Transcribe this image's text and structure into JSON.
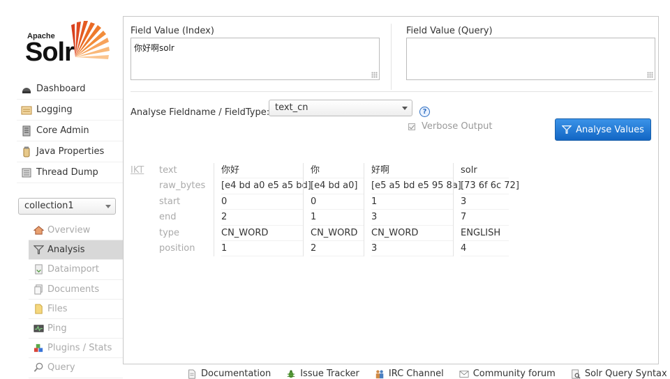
{
  "logo": {
    "brand_small": "Apache",
    "brand_large": "Solr"
  },
  "main_menu": [
    {
      "label": "Dashboard",
      "icon": "dashboard-icon"
    },
    {
      "label": "Logging",
      "icon": "logging-icon"
    },
    {
      "label": "Core Admin",
      "icon": "core-admin-icon"
    },
    {
      "label": "Java Properties",
      "icon": "java-properties-icon"
    },
    {
      "label": "Thread Dump",
      "icon": "thread-dump-icon"
    }
  ],
  "core_selector": {
    "value": "collection1"
  },
  "core_menu": [
    {
      "label": "Overview",
      "icon": "home-icon",
      "active": false
    },
    {
      "label": "Analysis",
      "icon": "filter-icon",
      "active": true
    },
    {
      "label": "Dataimport",
      "icon": "dataimport-icon",
      "active": false
    },
    {
      "label": "Documents",
      "icon": "documents-icon",
      "active": false
    },
    {
      "label": "Files",
      "icon": "files-icon",
      "active": false
    },
    {
      "label": "Ping",
      "icon": "ping-icon",
      "active": false
    },
    {
      "label": "Plugins / Stats",
      "icon": "plugins-icon",
      "active": false
    },
    {
      "label": "Query",
      "icon": "query-icon",
      "active": false
    }
  ],
  "analysis": {
    "index_label": "Field Value (Index)",
    "index_value": "你好啊solr",
    "query_label": "Field Value (Query)",
    "query_value": "",
    "fieldtype_label": "Analyse Fieldname / FieldType:",
    "fieldtype_value": "text_cn",
    "verbose_label": "Verbose Output",
    "verbose_checked": true,
    "analyse_button": "Analyse Values",
    "tokenizer": "IKT",
    "attributes": [
      "text",
      "raw_bytes",
      "start",
      "end",
      "type",
      "position"
    ],
    "tokens": [
      {
        "text": "你好",
        "raw_bytes": "[e4 bd a0 e5 a5 bd]",
        "start": "0",
        "end": "2",
        "type": "CN_WORD",
        "position": "1"
      },
      {
        "text": "你",
        "raw_bytes": "[e4 bd a0]",
        "start": "0",
        "end": "1",
        "type": "CN_WORD",
        "position": "2"
      },
      {
        "text": "好啊",
        "raw_bytes": "[e5 a5 bd e5 95 8a]",
        "start": "1",
        "end": "3",
        "type": "CN_WORD",
        "position": "3"
      },
      {
        "text": "solr",
        "raw_bytes": "[73 6f 6c 72]",
        "start": "3",
        "end": "7",
        "type": "ENGLISH",
        "position": "4"
      }
    ]
  },
  "footer": [
    {
      "label": "Documentation",
      "icon": "documentation-icon"
    },
    {
      "label": "Issue Tracker",
      "icon": "bug-icon"
    },
    {
      "label": "IRC Channel",
      "icon": "irc-icon"
    },
    {
      "label": "Community forum",
      "icon": "mail-icon"
    },
    {
      "label": "Solr Query Syntax",
      "icon": "query-syntax-icon"
    }
  ],
  "colors": {
    "accent": "#1a6fd0",
    "active_menu": "#d8d8d8",
    "muted_text": "#aaaaaa"
  }
}
